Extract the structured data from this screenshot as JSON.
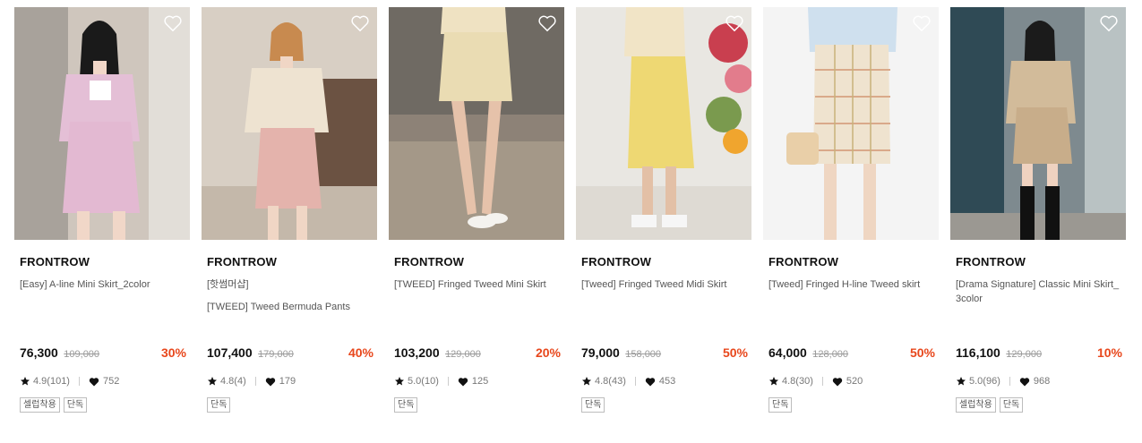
{
  "colors": {
    "discount": "#e8471c",
    "strike": "#9a9a9a",
    "tag_border": "#bdbdbd"
  },
  "icons": {
    "wishlist": "heart-outline-icon",
    "rating": "star-icon",
    "likes": "heart-filled-icon"
  },
  "products": [
    {
      "brand": "FRONTROW",
      "name": "[Easy] A-line Mini Skirt_2color",
      "name_line2": "",
      "price": "76,300",
      "original_price": "109,000",
      "discount": "30%",
      "rating": "4.9(101)",
      "likes": "752",
      "tags": [
        "셀럽착용",
        "단독"
      ]
    },
    {
      "brand": "FRONTROW",
      "name": "[핫썸머샵]",
      "name_line2": "[TWEED] Tweed Bermuda Pants",
      "price": "107,400",
      "original_price": "179,000",
      "discount": "40%",
      "rating": "4.8(4)",
      "likes": "179",
      "tags": [
        "단독"
      ]
    },
    {
      "brand": "FRONTROW",
      "name": "[TWEED] Fringed Tweed Mini Skirt",
      "name_line2": "",
      "price": "103,200",
      "original_price": "129,000",
      "discount": "20%",
      "rating": "5.0(10)",
      "likes": "125",
      "tags": [
        "단독"
      ]
    },
    {
      "brand": "FRONTROW",
      "name": "[Tweed] Fringed Tweed Midi Skirt",
      "name_line2": "",
      "price": "79,000",
      "original_price": "158,000",
      "discount": "50%",
      "rating": "4.8(43)",
      "likes": "453",
      "tags": [
        "단독"
      ]
    },
    {
      "brand": "FRONTROW",
      "name": "[Tweed] Fringed H-line Tweed skirt",
      "name_line2": "",
      "price": "64,000",
      "original_price": "128,000",
      "discount": "50%",
      "rating": "4.8(30)",
      "likes": "520",
      "tags": [
        "단독"
      ]
    },
    {
      "brand": "FRONTROW",
      "name": "[Drama Signature] Classic Mini Skirt_3color",
      "name_line2": "",
      "price": "116,100",
      "original_price": "129,000",
      "discount": "10%",
      "rating": "5.0(96)",
      "likes": "968",
      "tags": [
        "셀럽착용",
        "단독"
      ]
    }
  ]
}
